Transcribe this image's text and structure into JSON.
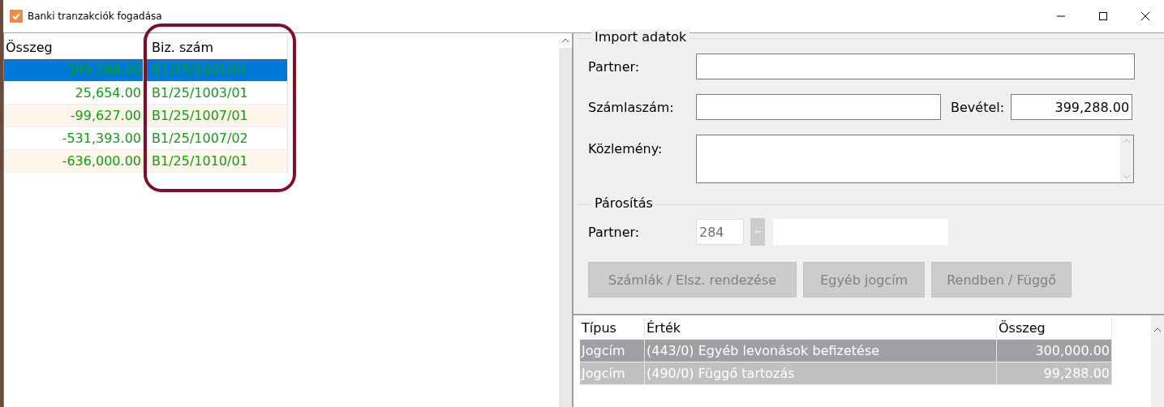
{
  "window": {
    "title": "Banki tranzakciók fogadása"
  },
  "transactions": {
    "columns": [
      "Összeg",
      "Biz. szám"
    ],
    "rows": [
      {
        "amount": "399,288.00",
        "doc": "B1/25/1001/01",
        "selected": true
      },
      {
        "amount": "25,654.00",
        "doc": "B1/25/1003/01",
        "selected": false
      },
      {
        "amount": "-99,627.00",
        "doc": "B1/25/1007/01",
        "selected": false
      },
      {
        "amount": "-531,393.00",
        "doc": "B1/25/1007/02",
        "selected": false
      },
      {
        "amount": "-636,000.00",
        "doc": "B1/25/1010/01",
        "selected": false
      }
    ]
  },
  "import_group": {
    "title": "Import adatok",
    "partner_label": "Partner:",
    "account_label": "Számlaszám:",
    "income_label": "Bevétel:",
    "income_value": "399,288.00",
    "note_label": "Közlemény:"
  },
  "matching_group": {
    "title": "Párosítás",
    "partner_label": "Partner:",
    "partner_code": "284",
    "buttons": [
      {
        "label": "Számlák / Elsz. rendezése",
        "disabled": true
      },
      {
        "label": "Egyéb jogcím",
        "disabled": true
      },
      {
        "label": "Rendben / Függő",
        "disabled": true
      }
    ]
  },
  "allocations": {
    "columns": [
      "Típus",
      "Érték",
      "Összeg"
    ],
    "rows": [
      {
        "type": "Jogcím",
        "value": "(443/0) Egyéb levonások befizetése",
        "amount": "300,000.00",
        "selected": true,
        "focused": true
      },
      {
        "type": "Jogcím",
        "value": "(490/0) Függő tartozás",
        "amount": "99,288.00",
        "selected": true,
        "focused": false
      }
    ]
  }
}
